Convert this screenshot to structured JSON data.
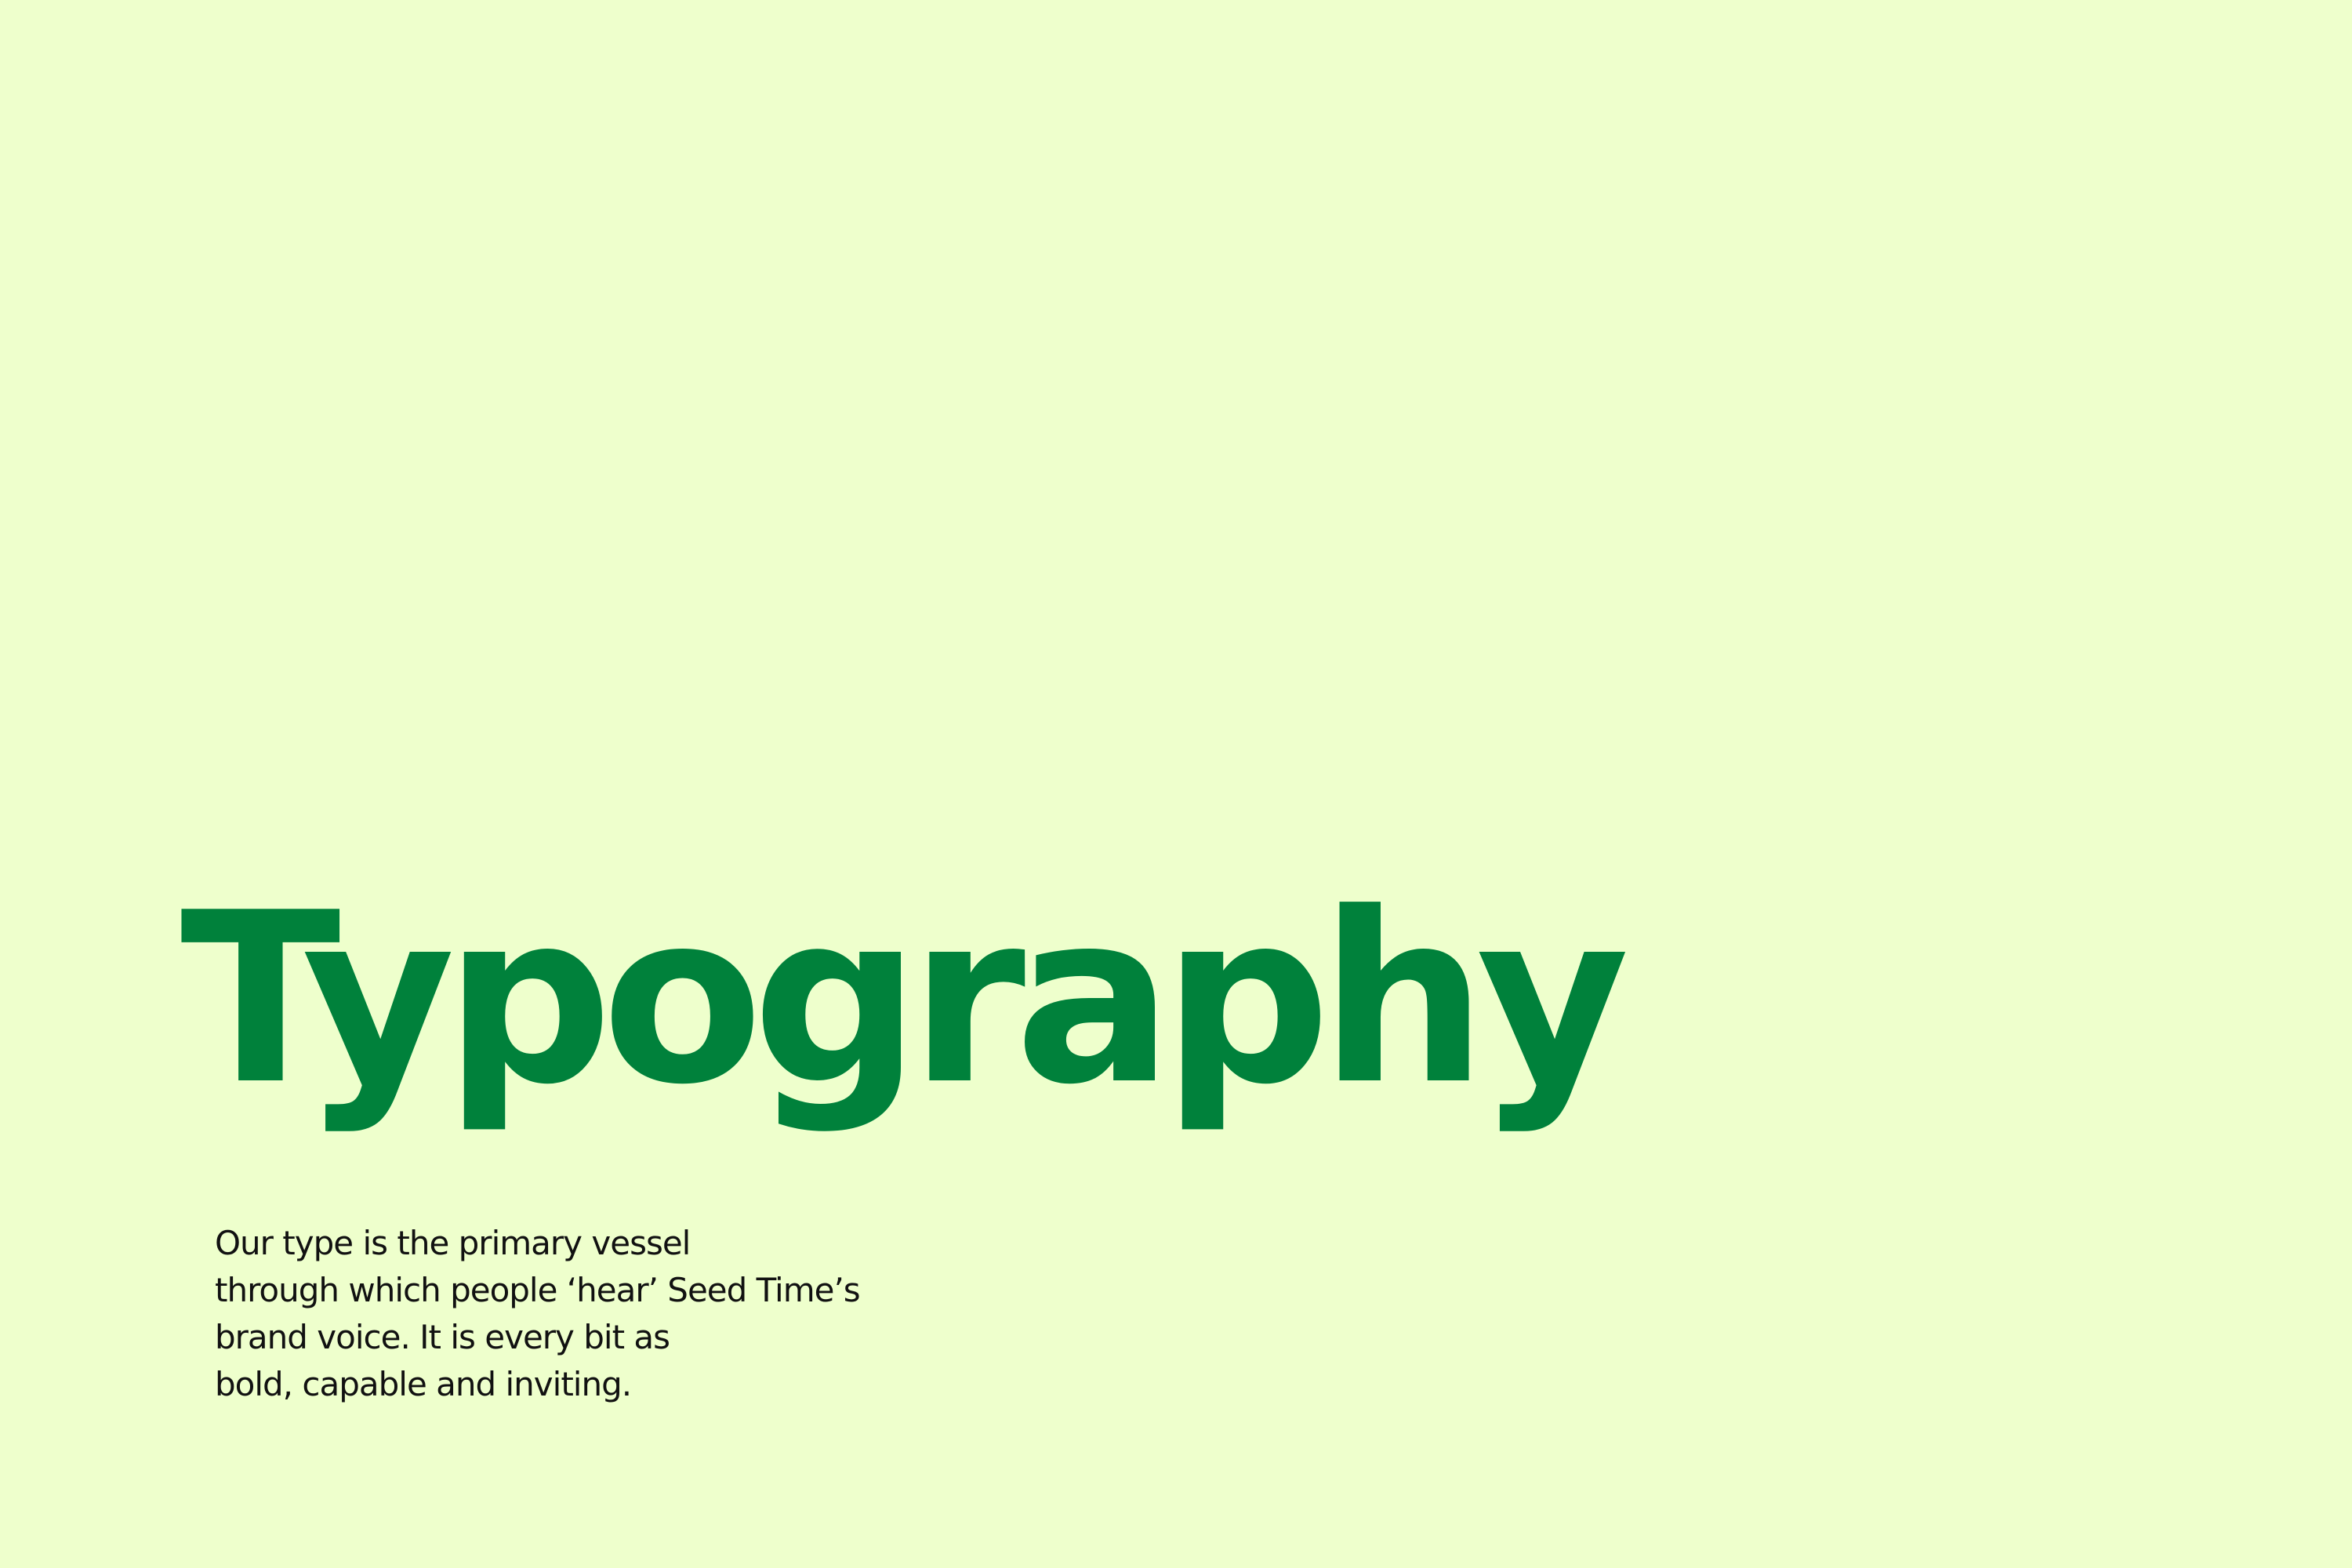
{
  "colors": {
    "background": "#eeffcc",
    "title": "#00813b",
    "body_text": "#111111"
  },
  "slide": {
    "title": "Typography",
    "body_lines": [
      "Our type is the primary vessel",
      "through which people ‘hear’ Seed Time’s",
      "brand voice. It is every bit as",
      "bold, capable and inviting."
    ]
  }
}
